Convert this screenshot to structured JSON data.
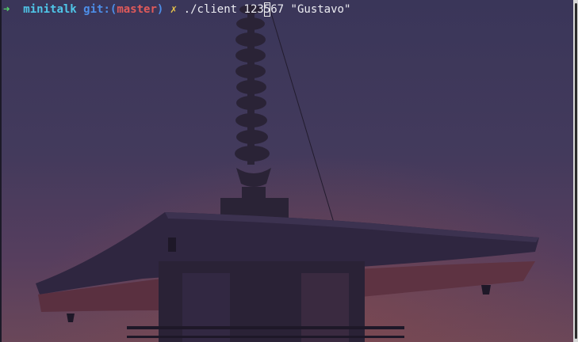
{
  "prompt": {
    "arrow": "➜",
    "directory": "minitalk",
    "git_prefix": "git:(",
    "branch": "master",
    "git_suffix": ")",
    "dirty_marker": "✗",
    "command_before_cursor": "./client 123",
    "cursor_char": "5",
    "command_after_cursor": "67 \"Gustavo\""
  },
  "colors": {
    "arrow": "#55d36a",
    "directory": "#4fc6e8",
    "git": "#4d8ee8",
    "branch": "#e05a5a",
    "dirty": "#e8c44a"
  },
  "background": {
    "image": "pagoda-silhouette-dusk"
  }
}
